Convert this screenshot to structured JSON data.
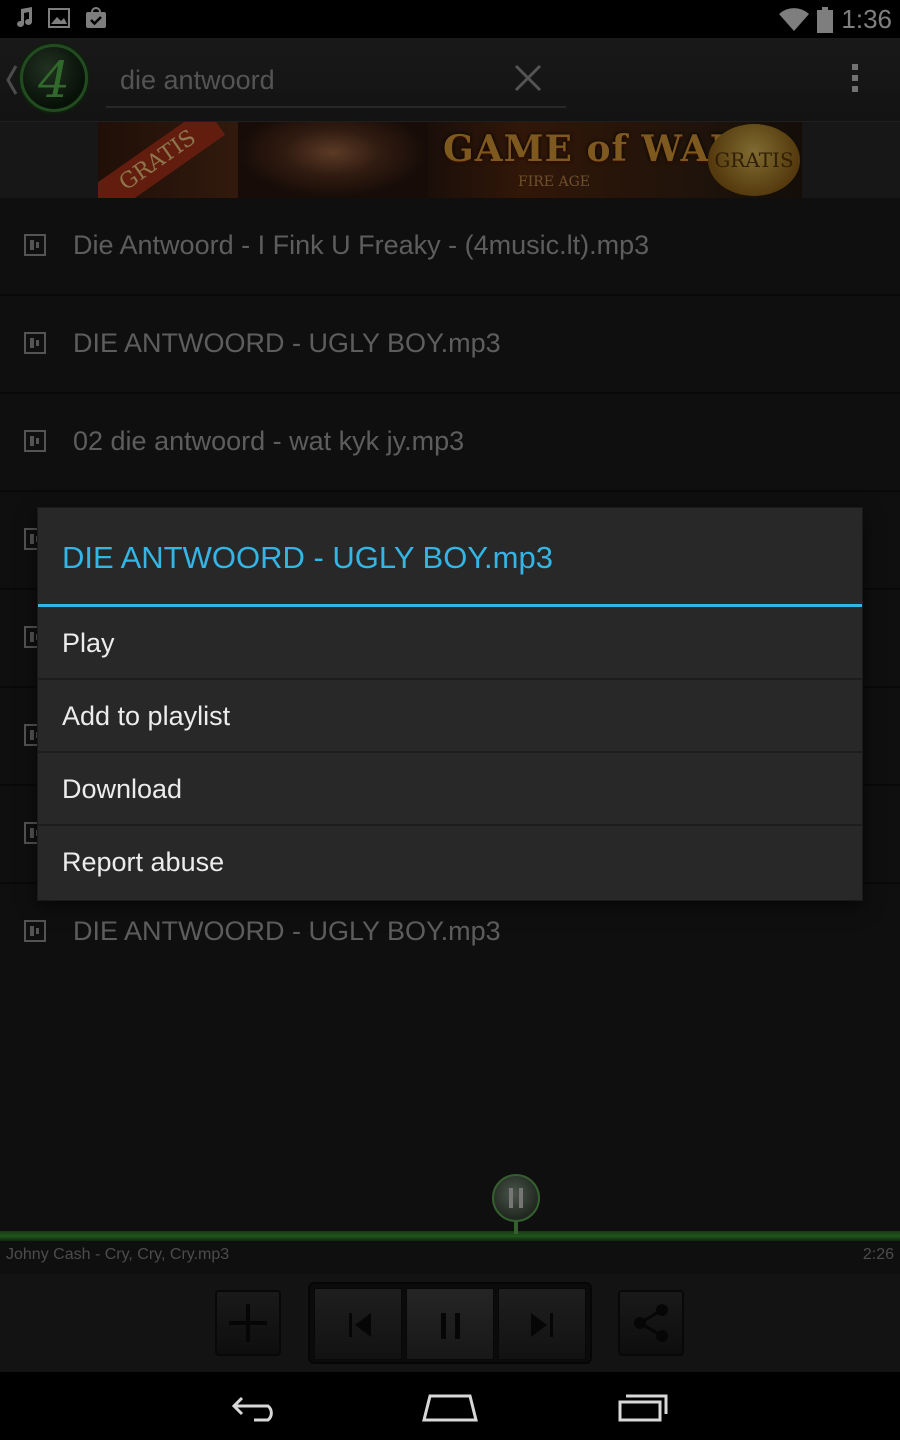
{
  "status_bar": {
    "time": "1:36",
    "left_icons": [
      "music-note-icon",
      "image-icon",
      "shopping-bag-icon"
    ],
    "right_icons": [
      "wifi-icon",
      "battery-icon"
    ]
  },
  "action_bar": {
    "logo_text": "4",
    "search": {
      "value": "die antwoord",
      "placeholder": ""
    }
  },
  "ad": {
    "ribbon": "GRATIS",
    "title": "GAME of WAR",
    "subtitle": "FIRE AGE",
    "seal": "GRATIS"
  },
  "results": [
    "Die Antwoord - I Fink U Freaky - (4music.lt).mp3",
    "DIE ANTWOORD - UGLY BOY.mp3",
    "02 die antwoord - wat kyk jy.mp3",
    "",
    "",
    "",
    "",
    "DIE ANTWOORD - UGLY BOY.mp3"
  ],
  "dialog": {
    "title": "DIE ANTWOORD - UGLY BOY.mp3",
    "items": [
      "Play",
      "Add to playlist",
      "Download",
      "Report abuse"
    ]
  },
  "player": {
    "track": "Johny Cash - Cry, Cry, Cry.mp3",
    "duration": "2:26"
  },
  "colors": {
    "accent": "#33b5e5",
    "progress": "#3e9a34",
    "list_bg": "#1c1c1c",
    "dialog_bg": "#282828"
  }
}
